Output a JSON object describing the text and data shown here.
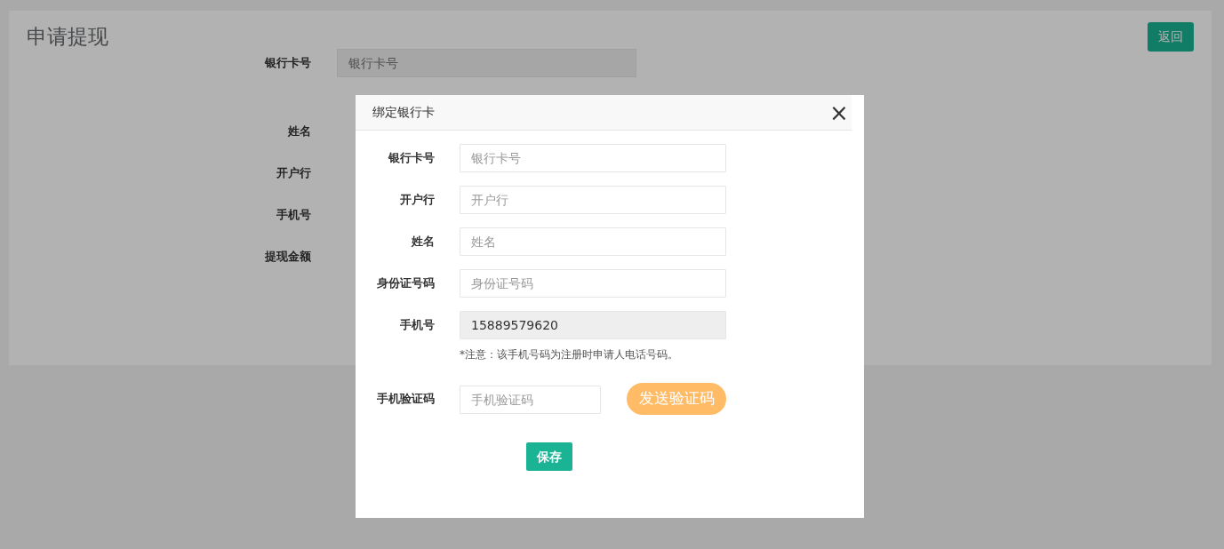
{
  "page": {
    "title": "申请提现",
    "back_button": "返回",
    "form": [
      {
        "label": "银行卡号",
        "placeholder": "银行卡号",
        "readonly": true
      },
      {
        "label": "姓名"
      },
      {
        "label": "开户行"
      },
      {
        "label": "手机号"
      },
      {
        "label": "提现金额"
      }
    ]
  },
  "modal": {
    "title": "绑定银行卡",
    "close": "×",
    "fields": [
      {
        "kind": "input",
        "label": "银行卡号",
        "placeholder": "银行卡号",
        "readonly": false
      },
      {
        "kind": "input",
        "label": "开户行",
        "placeholder": "开户行",
        "readonly": false
      },
      {
        "kind": "input",
        "label": "姓名",
        "placeholder": "姓名",
        "readonly": false
      },
      {
        "kind": "input",
        "label": "身份证号码",
        "placeholder": "身份证号码",
        "readonly": false
      },
      {
        "kind": "input",
        "label": "手机号",
        "value": "15889579620",
        "readonly": true,
        "note": "*注意：该手机号码为注册时申请人电话号码。"
      },
      {
        "kind": "code",
        "label": "手机验证码",
        "placeholder": "手机验证码",
        "readonly": false,
        "button": "发送验证码"
      }
    ],
    "save_button": "保存"
  }
}
